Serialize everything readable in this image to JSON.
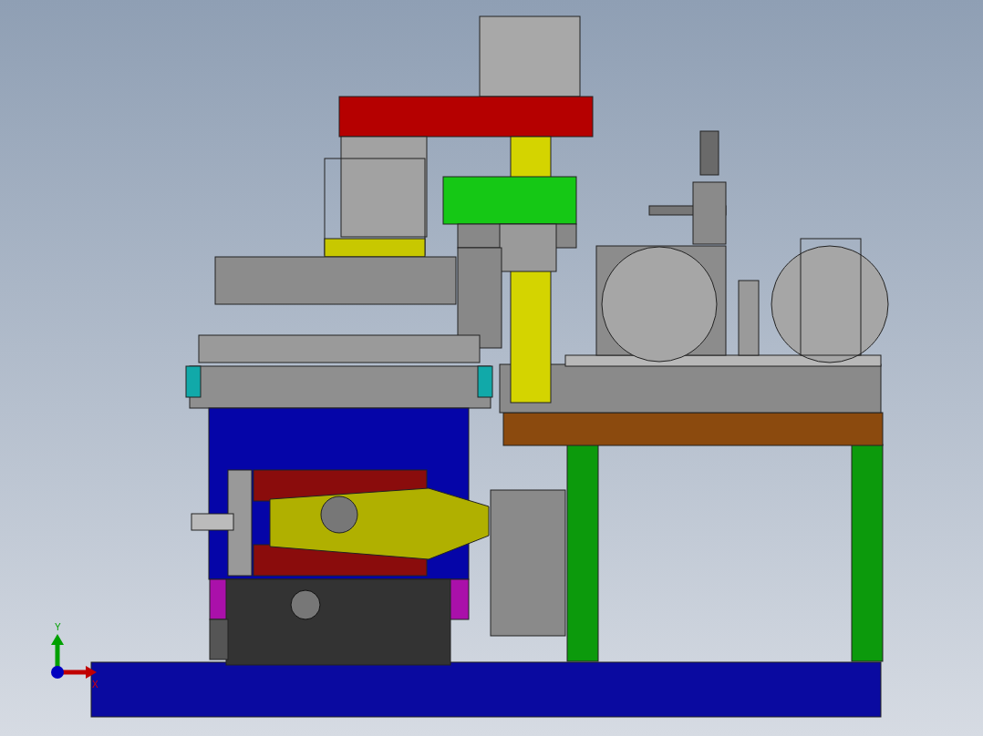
{
  "viewport": {
    "axes": [
      {
        "label": "Y",
        "kind": "y"
      },
      {
        "label": "X",
        "kind": "x"
      }
    ]
  }
}
